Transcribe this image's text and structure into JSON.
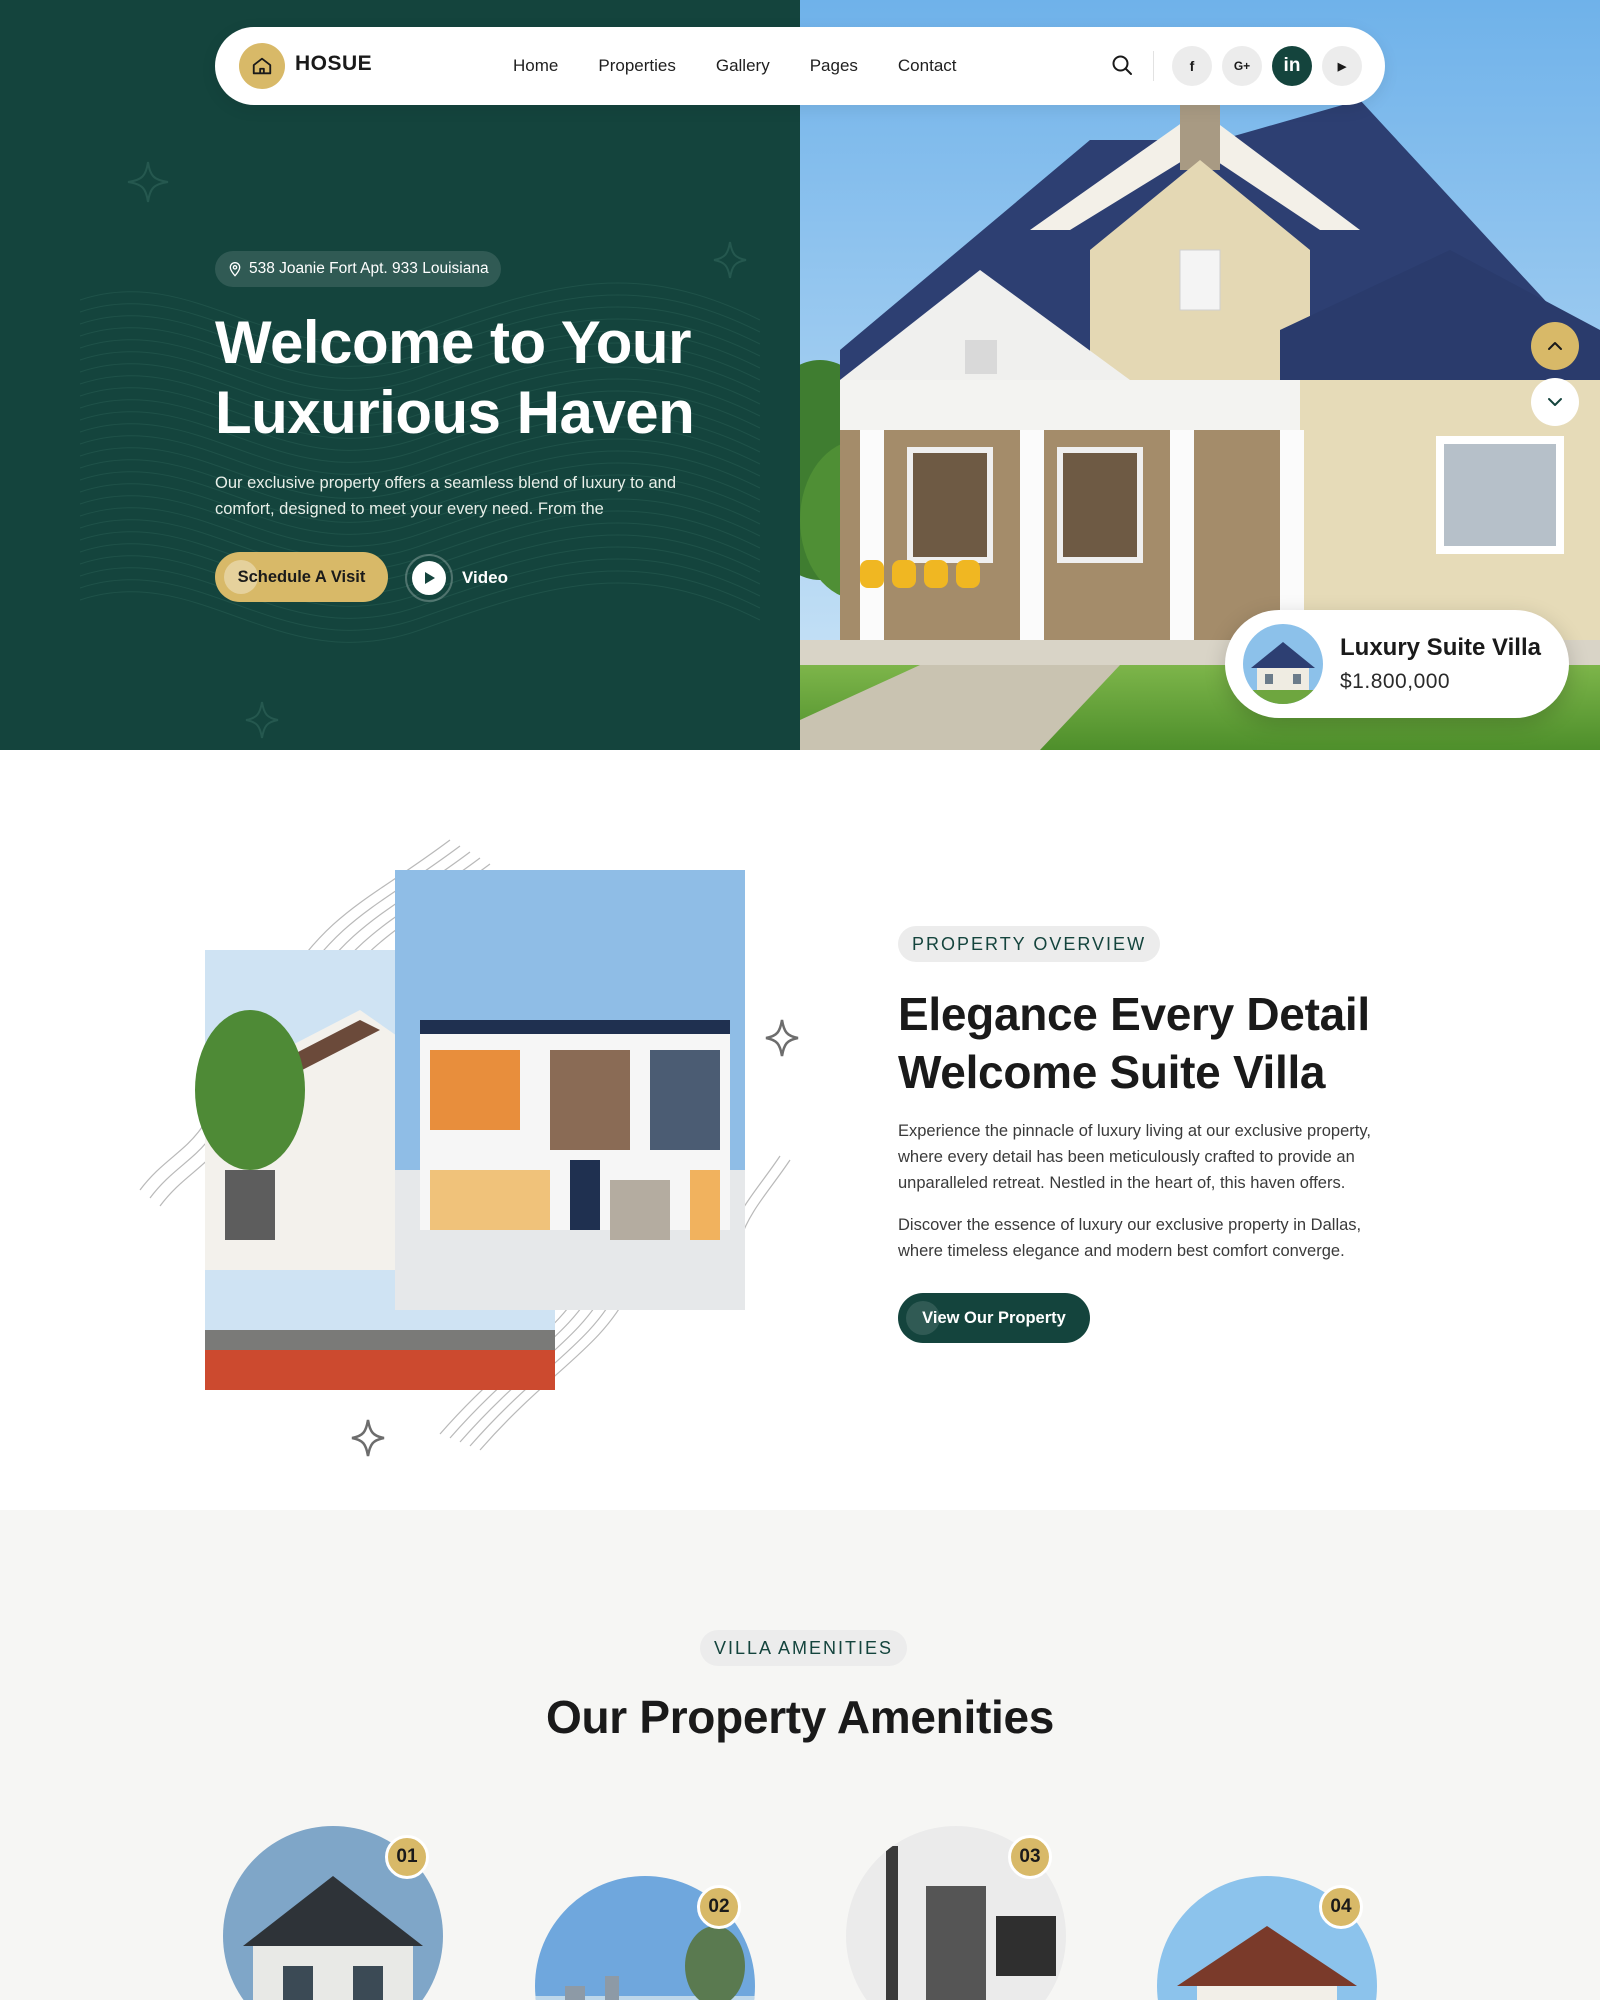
{
  "brand": {
    "name": "HOSUE",
    "accent": "#d8b968",
    "primary": "#14443d"
  },
  "nav": {
    "links": [
      "Home",
      "Properties",
      "Gallery",
      "Pages",
      "Contact"
    ],
    "social": [
      {
        "icon": "facebook-icon",
        "glyph": "f"
      },
      {
        "icon": "google-plus-icon",
        "glyph": "G+"
      },
      {
        "icon": "linkedin-icon",
        "glyph": "in"
      },
      {
        "icon": "youtube-icon",
        "glyph": "▶"
      }
    ]
  },
  "hero": {
    "address": "538 Joanie Fort Apt. 933 Louisiana",
    "title": "Welcome to Your Luxurious Haven",
    "description": "Our exclusive property offers a seamless blend of luxury to and comfort, designed to meet your every need. From the",
    "cta_label": "Schedule A Visit",
    "video_label": "Video",
    "card": {
      "name": "Luxury Suite Villa",
      "price": "$1.800,000"
    }
  },
  "overview": {
    "tag": "PROPERTY OVERVIEW",
    "title": "Elegance Every Detail Welcome Suite Villa",
    "paragraph1": "Experience the pinnacle of luxury living at our exclusive property, where every detail has been meticulously crafted to provide an unparalleled retreat. Nestled in the heart of, this haven offers.",
    "paragraph2": "Discover the essence of luxury  our exclusive property in Dallas, where timeless elegance and modern best comfort converge.",
    "cta_label": "View Our Property"
  },
  "amenities": {
    "tag": "VILLA AMENITIES",
    "title": "Our Property Amenities",
    "items": [
      {
        "number": "01"
      },
      {
        "number": "02"
      },
      {
        "number": "03"
      },
      {
        "number": "04"
      }
    ]
  }
}
